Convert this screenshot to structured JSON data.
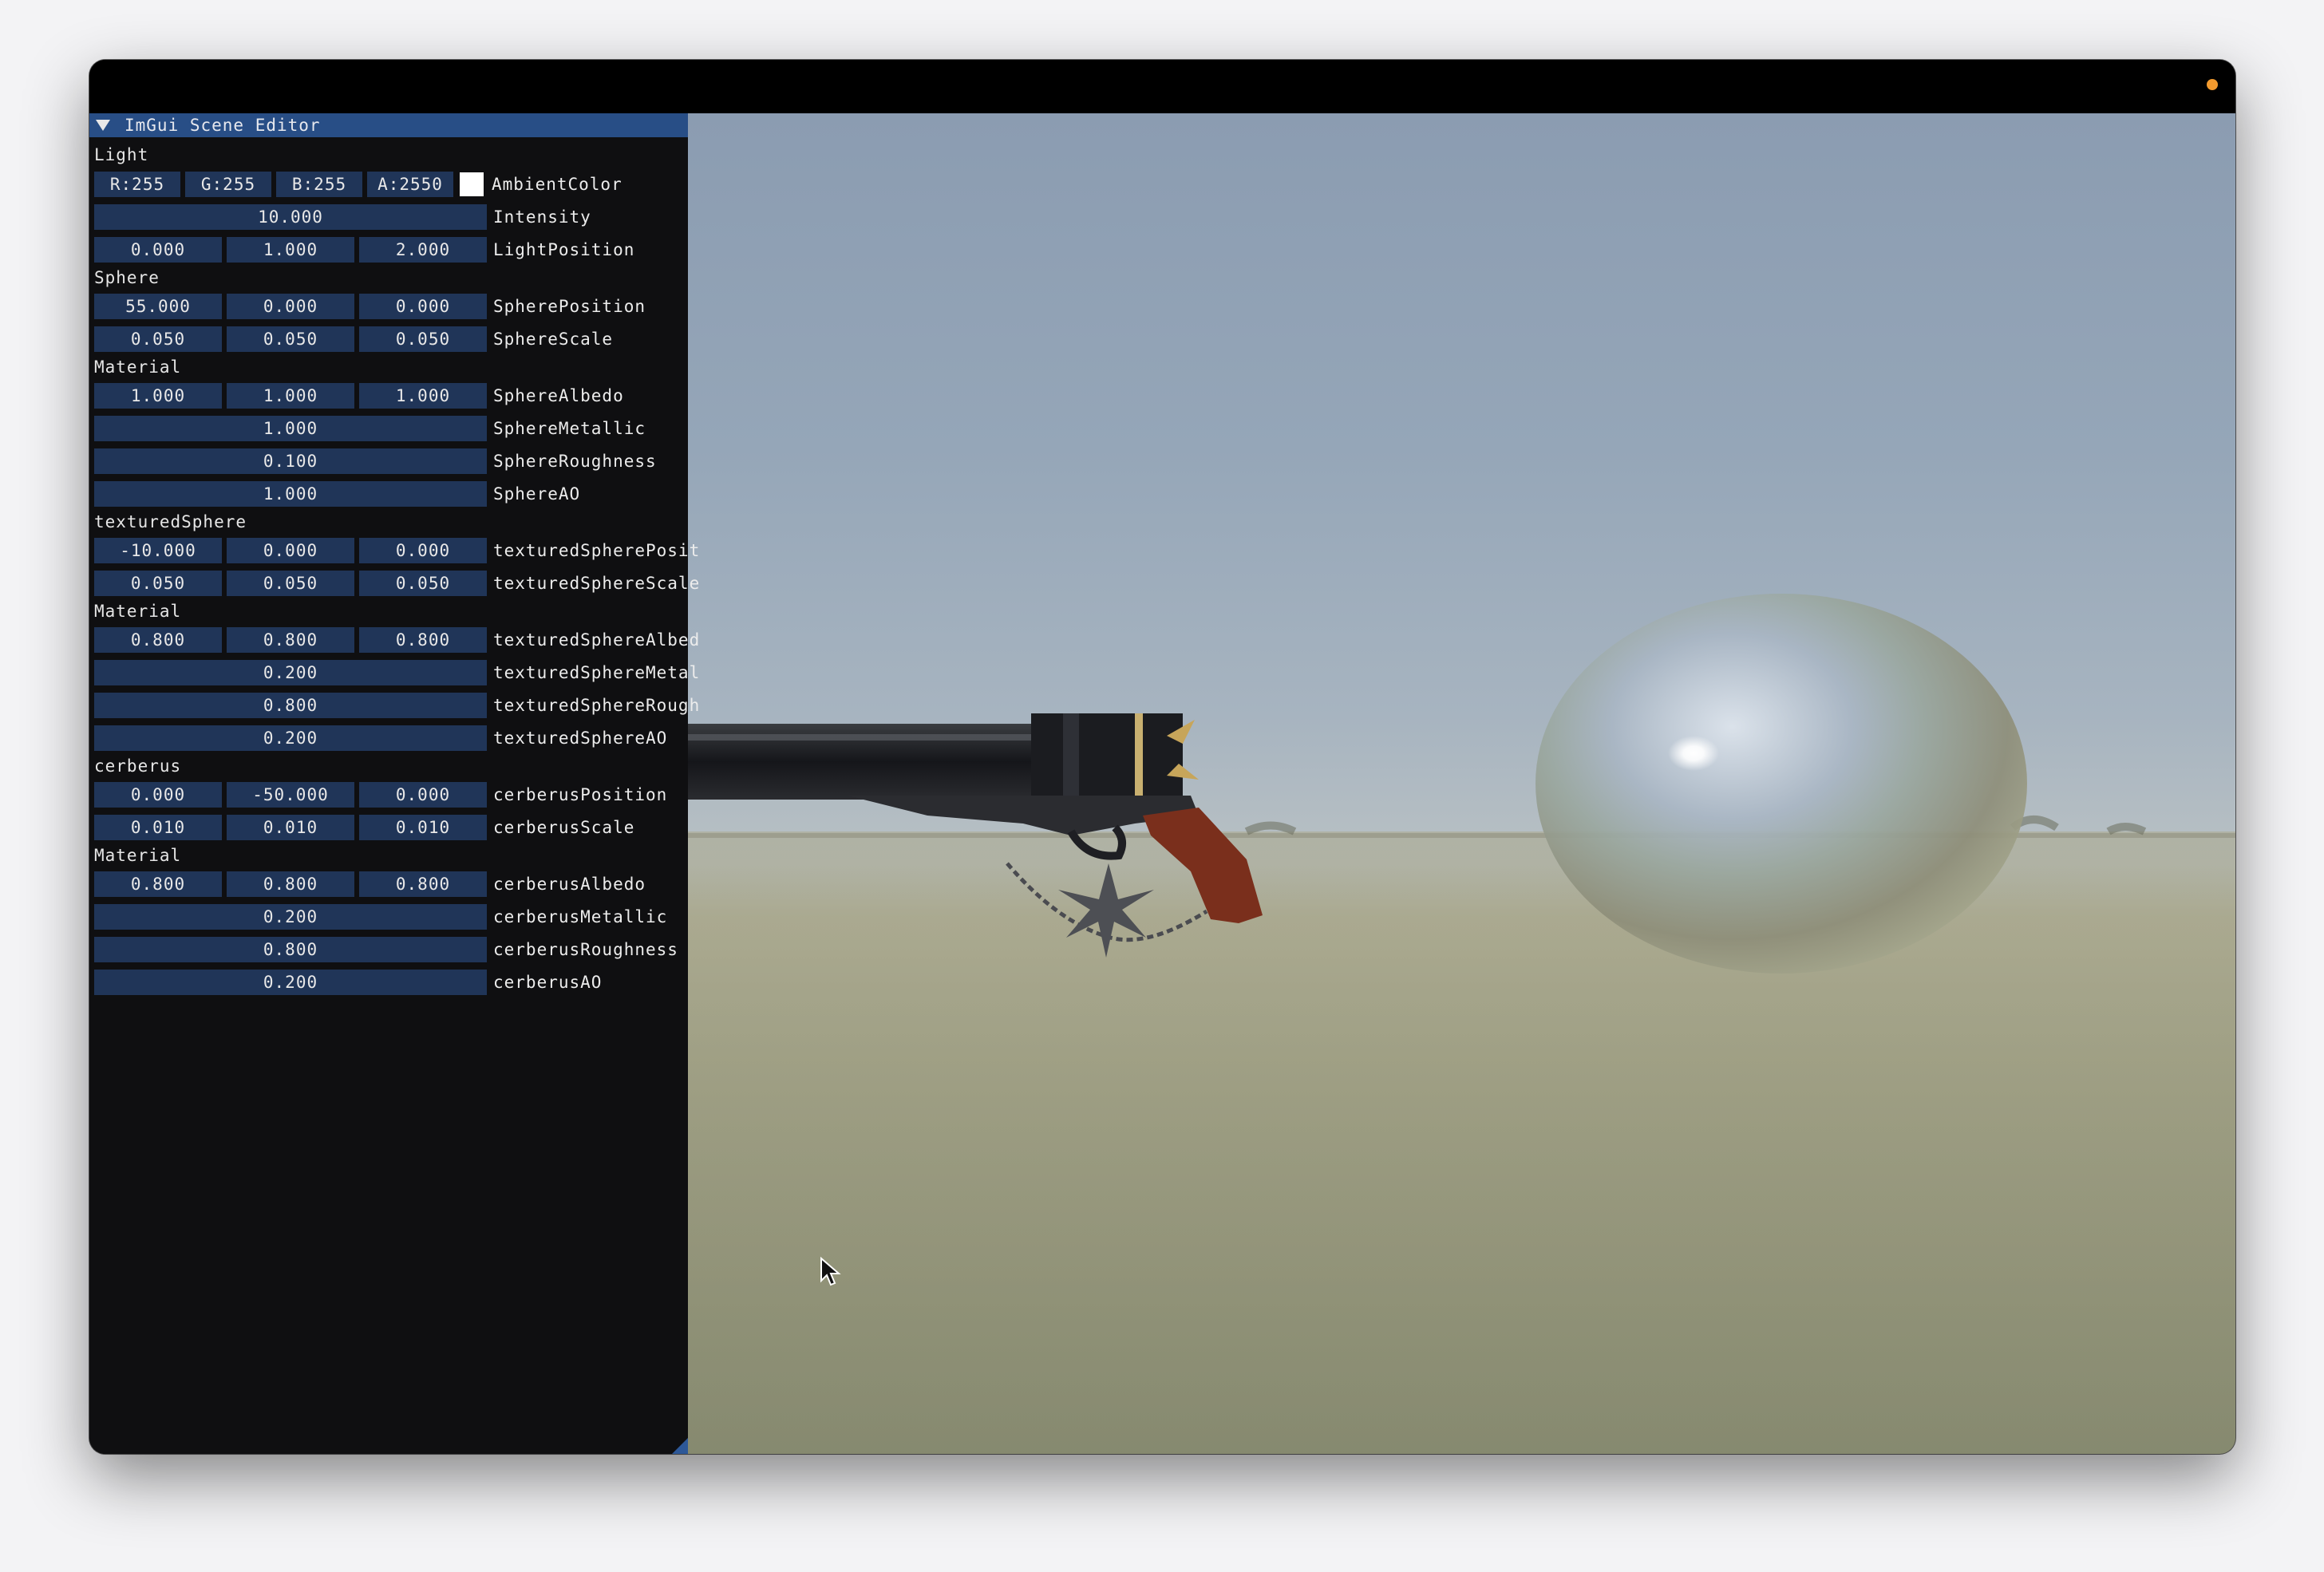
{
  "panel": {
    "title": "ImGui Scene Editor",
    "sections": {
      "light": "Light",
      "sphere": "Sphere",
      "material1": "Material",
      "textured_sphere": "texturedSphere",
      "material2": "Material",
      "cerberus": "cerberus",
      "material3": "Material"
    },
    "ambient": {
      "r": "R:255",
      "g": "G:255",
      "b": "B:255",
      "a": "A:2550",
      "label": "AmbientColor",
      "swatch_color": "#ffffff"
    },
    "intensity": {
      "value": "10.000",
      "label": "Intensity"
    },
    "light_position": {
      "values": [
        "0.000",
        "1.000",
        "2.000"
      ],
      "label": "LightPosition"
    },
    "sphere_position": {
      "values": [
        "55.000",
        "0.000",
        "0.000"
      ],
      "label": "SpherePosition"
    },
    "sphere_scale": {
      "values": [
        "0.050",
        "0.050",
        "0.050"
      ],
      "label": "SphereScale"
    },
    "sphere_albedo": {
      "values": [
        "1.000",
        "1.000",
        "1.000"
      ],
      "label": "SphereAlbedo"
    },
    "sphere_metallic": {
      "value": "1.000",
      "label": "SphereMetallic"
    },
    "sphere_roughness": {
      "value": "0.100",
      "label": "SphereRoughness"
    },
    "sphere_ao": {
      "value": "1.000",
      "label": "SphereAO"
    },
    "tsphere_position": {
      "values": [
        "-10.000",
        "0.000",
        "0.000"
      ],
      "label": "texturedSpherePosit"
    },
    "tsphere_scale": {
      "values": [
        "0.050",
        "0.050",
        "0.050"
      ],
      "label": "texturedSphereScale"
    },
    "tsphere_albedo": {
      "values": [
        "0.800",
        "0.800",
        "0.800"
      ],
      "label": "texturedSphereAlbed"
    },
    "tsphere_metal": {
      "value": "0.200",
      "label": "texturedSphereMetal"
    },
    "tsphere_rough": {
      "value": "0.800",
      "label": "texturedSphereRough"
    },
    "tsphere_ao": {
      "value": "0.200",
      "label": "texturedSphereAO"
    },
    "cerberus_position": {
      "values": [
        "0.000",
        "-50.000",
        "0.000"
      ],
      "label": "cerberusPosition"
    },
    "cerberus_scale": {
      "values": [
        "0.010",
        "0.010",
        "0.010"
      ],
      "label": "cerberusScale"
    },
    "cerberus_albedo": {
      "values": [
        "0.800",
        "0.800",
        "0.800"
      ],
      "label": "cerberusAlbedo"
    },
    "cerberus_metallic": {
      "value": "0.200",
      "label": "cerberusMetallic"
    },
    "cerberus_roughness": {
      "value": "0.800",
      "label": "cerberusRoughness"
    },
    "cerberus_ao": {
      "value": "0.200",
      "label": "cerberusAO"
    }
  },
  "colors": {
    "header_bg": "#284e86",
    "field_bg": "#203558",
    "panel_bg": "#101012",
    "window_dot": "#f29a2e"
  },
  "icons": {
    "collapse": "collapse-arrow-icon",
    "cursor": "mouse-cursor-icon"
  }
}
